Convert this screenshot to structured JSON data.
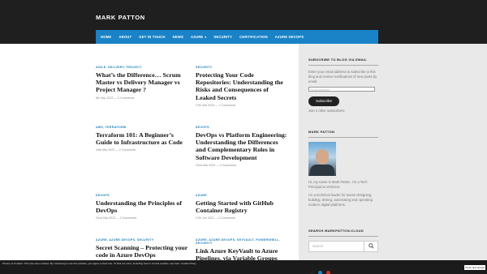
{
  "site": {
    "title": "MARK PATTON"
  },
  "nav": [
    {
      "label": "HOME",
      "dropdown": false
    },
    {
      "label": "ABOUT",
      "dropdown": false
    },
    {
      "label": "GET IN TOUCH",
      "dropdown": false
    },
    {
      "label": "NEWS",
      "dropdown": false
    },
    {
      "label": "AZURE",
      "dropdown": true
    },
    {
      "label": "SECURITY",
      "dropdown": false
    },
    {
      "label": "CERTIFICATION",
      "dropdown": false
    },
    {
      "label": "AZURE DEVOPS",
      "dropdown": false
    }
  ],
  "posts": [
    {
      "category": "AGILE, DELIVERY, PROJECT",
      "title": "What’s the Difference… Scrum Master vs Delivery Manager vs Project Manager ?",
      "meta": "8th Sep 2023 — 0 Comments"
    },
    {
      "category": "SECURITY",
      "title": "Protecting Your Code Repositories: Understanding the Risks and Consequences of Leaked Secrets",
      "meta": "17th Mar 2023 — 2 Comments"
    },
    {
      "category": "AWS, TERRAFORM",
      "title": "Terraform 101: A Beginner’s Guide to Infrastructure as Code",
      "meta": "24th Mar 2023 — 2 Comments"
    },
    {
      "category": "DEVOPS",
      "title": "DevOps vs Platform Engineering: Understanding the Differences and Complementary Roles in Software Development",
      "meta": "22nd Mar 2023 — 0 Comments"
    },
    {
      "category": "DEVOPS",
      "title": "Understanding the Principles of DevOps",
      "meta": "22nd Mar 2023 — 0 Comments"
    },
    {
      "category": "AZURE",
      "title": "Getting Started with GitHub Container Registry",
      "meta": "17th Jun 2021 — 0 Comments"
    },
    {
      "category": "AZURE, AZURE DEVOPS, SECURITY",
      "title": "Secret Scanning – Protecting your code in Azure DevOps",
      "meta": ""
    },
    {
      "category": "AZURE, AZURE DEVOPS, KEYVAULT, POWERSHELL, SECURITY",
      "title": "Link Azure KeyVault to Azure Pipelines, via Variable Groups",
      "meta": ""
    }
  ],
  "sidebar": {
    "subscribe": {
      "title": "SUBSCRIBE TO BLOG VIA EMAIL",
      "text": "Enter your email address to subscribe to this blog and receive notifications of new posts by email.",
      "placeholder": "Email Address",
      "button": "Subscribe",
      "count": "Join 4 other subscribers"
    },
    "about": {
      "title": "MARK PATTON",
      "text1": "Hi, my name is Mark Patton. I'm a Tech Principal at Version1.",
      "text2": "I'm a technical leader for teams designing, building, testing, automating and operating modern digital platforms."
    },
    "search": {
      "title": "SEARCH MARKPATTON.CLOUD",
      "placeholder": "Search"
    }
  },
  "cookie": {
    "text": "Privacy & Cookies: This site uses cookies. By continuing to use this website, you agree to their use. To find out more, including how to control cookies, see here: Cookie Policy",
    "button": "Close and accept"
  },
  "colors": {
    "accent": "#1a82c6",
    "header": "#1f1f1f",
    "sidebar": "#e9e9e9"
  }
}
